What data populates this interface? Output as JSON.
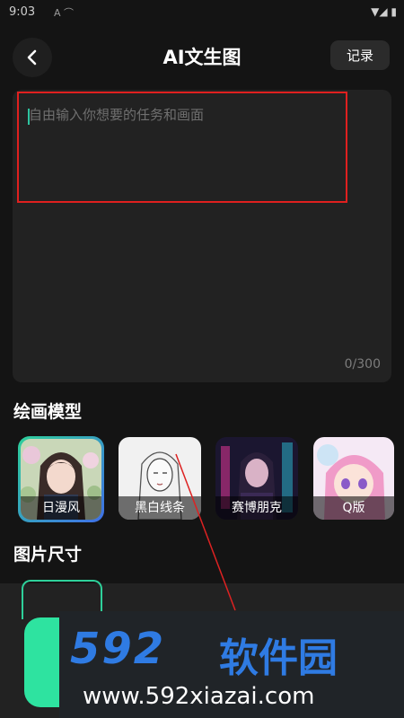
{
  "status": {
    "time": "9:03",
    "left_icons": "A ⌒",
    "right_icons": "▼◢ ▮"
  },
  "header": {
    "title": "AI文生图",
    "record_label": "记录"
  },
  "input": {
    "placeholder": "自由输入你想要的任务和画面",
    "counter": "0/300"
  },
  "models": {
    "heading": "绘画模型",
    "items": [
      {
        "label": "日漫风",
        "selected": true
      },
      {
        "label": "黑白线条",
        "selected": false
      },
      {
        "label": "赛博朋克",
        "selected": false
      },
      {
        "label": "Q版",
        "selected": false
      }
    ]
  },
  "size": {
    "heading": "图片尺寸"
  },
  "watermark": {
    "brand": "592",
    "brand_cn": "软件园",
    "url": "www.592xiazai.com"
  },
  "colors": {
    "accent": "#2ee3a0",
    "highlight": "#e0201f",
    "brand": "#2f7be3"
  }
}
